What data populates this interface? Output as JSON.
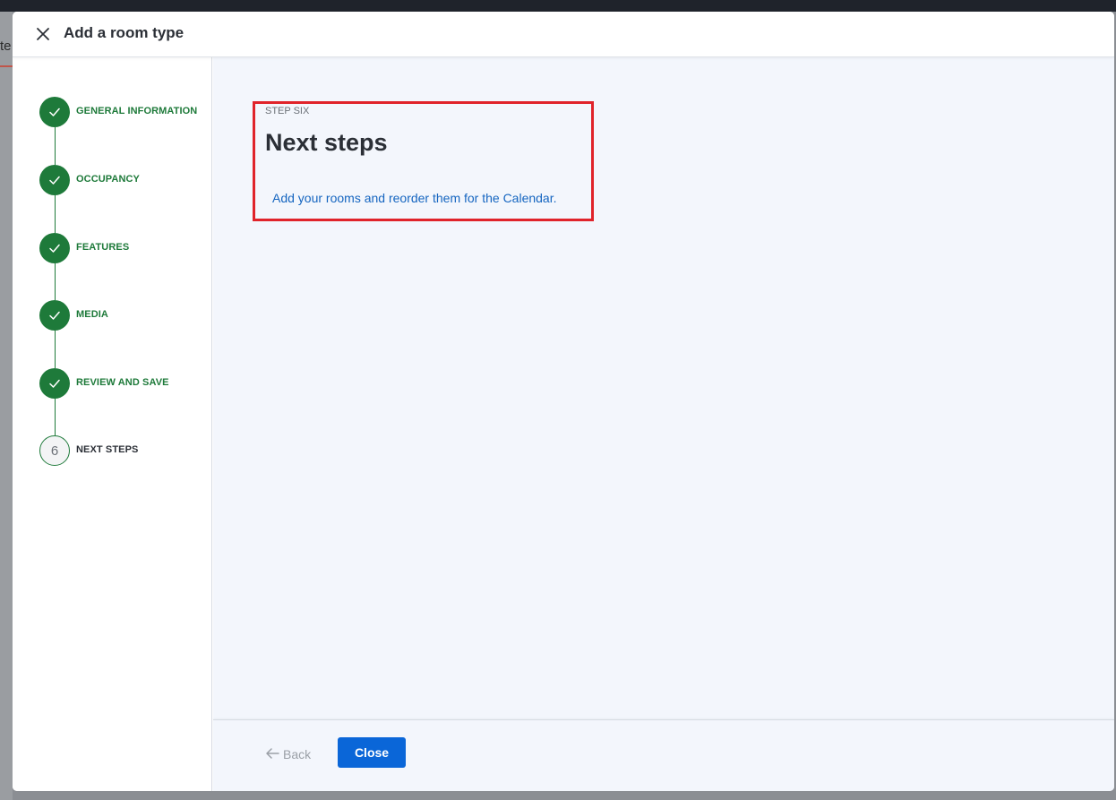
{
  "modal": {
    "title": "Add a room type"
  },
  "background": {
    "peek_text": "te"
  },
  "steps": [
    {
      "label": "GENERAL INFORMATION",
      "status": "complete"
    },
    {
      "label": "OCCUPANCY",
      "status": "complete"
    },
    {
      "label": "FEATURES",
      "status": "complete"
    },
    {
      "label": "MEDIA",
      "status": "complete"
    },
    {
      "label": "REVIEW AND SAVE",
      "status": "complete"
    },
    {
      "label": "NEXT STEPS",
      "status": "current",
      "number": "6"
    }
  ],
  "content": {
    "eyebrow": "STEP SIX",
    "heading": "Next steps",
    "link_text": "Add your rooms and reorder them for the Calendar."
  },
  "footer": {
    "back_label": "Back",
    "close_label": "Close"
  },
  "colors": {
    "accent_green": "#1e7a3a",
    "primary_blue": "#0a66d8",
    "link_blue": "#1565c0",
    "highlight_red": "#e0232a"
  }
}
